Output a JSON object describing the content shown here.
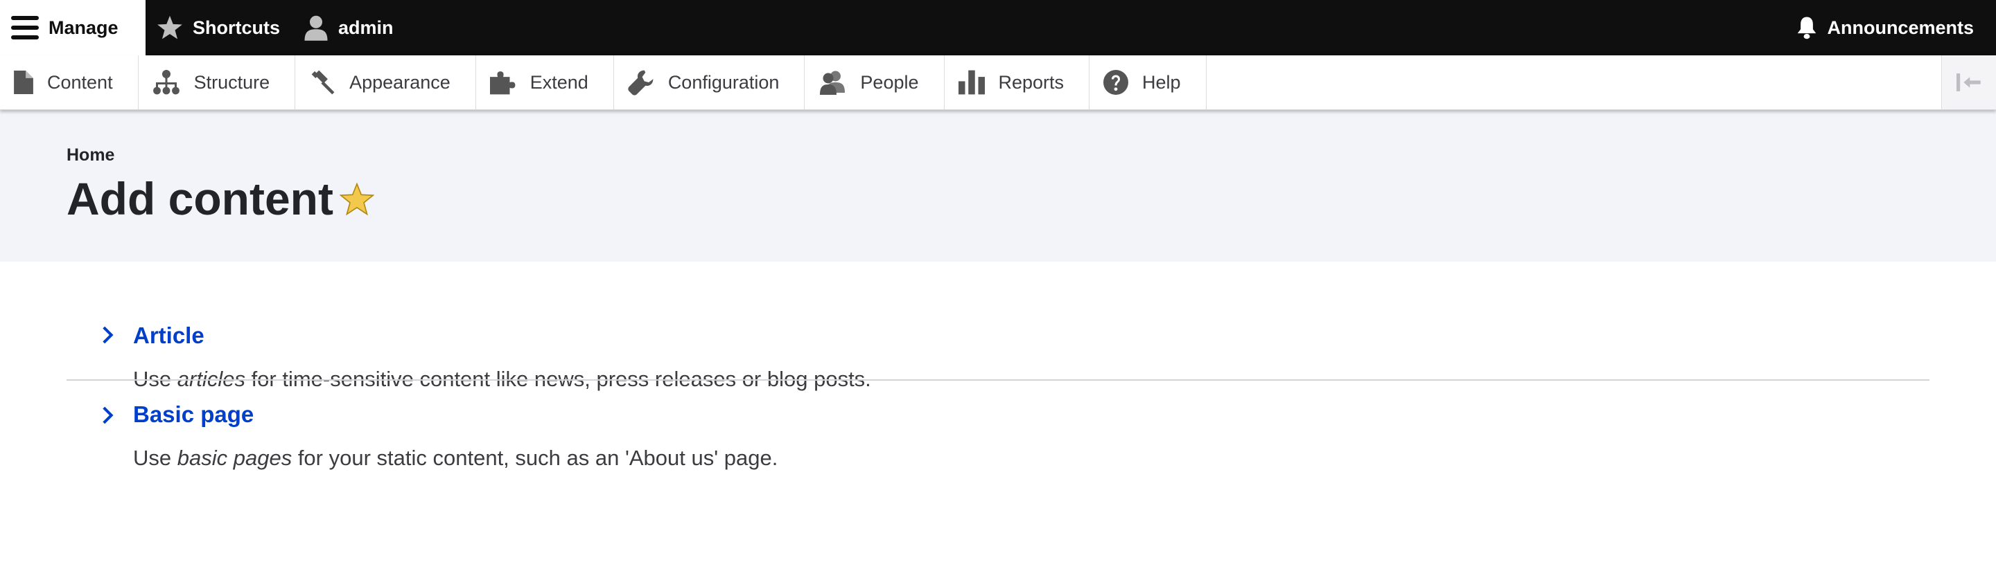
{
  "toolbar": {
    "manage": {
      "label": "Manage",
      "icon": "hamburger-icon"
    },
    "shortcuts": {
      "label": "Shortcuts",
      "icon": "star-icon"
    },
    "user": {
      "label": "admin",
      "icon": "user-icon"
    },
    "announcements": {
      "label": "Announcements",
      "icon": "bell-icon"
    }
  },
  "tray": {
    "items": [
      {
        "label": "Content",
        "icon": "file-icon"
      },
      {
        "label": "Structure",
        "icon": "sitemap-icon"
      },
      {
        "label": "Appearance",
        "icon": "paintbrush-icon"
      },
      {
        "label": "Extend",
        "icon": "puzzle-icon"
      },
      {
        "label": "Configuration",
        "icon": "wrench-icon"
      },
      {
        "label": "People",
        "icon": "people-icon"
      },
      {
        "label": "Reports",
        "icon": "bar-chart-icon"
      },
      {
        "label": "Help",
        "icon": "help-icon"
      }
    ],
    "orientation_toggle_icon": "orientation-toggle-icon"
  },
  "header": {
    "breadcrumb": "Home",
    "title": "Add content",
    "shortcut_star_color": "#f2c94c"
  },
  "node_types": [
    {
      "label": "Article",
      "desc_before": "Use ",
      "desc_em": "articles",
      "desc_after": " for time-sensitive content like news, press releases or blog posts."
    },
    {
      "label": "Basic page",
      "desc_before": "Use ",
      "desc_em": "basic pages",
      "desc_after": " for your static content, such as an 'About us' page."
    }
  ],
  "colors": {
    "toolbar_bg": "#0f0f0f",
    "link": "#003ecc",
    "header_bg": "#f3f4f9"
  }
}
